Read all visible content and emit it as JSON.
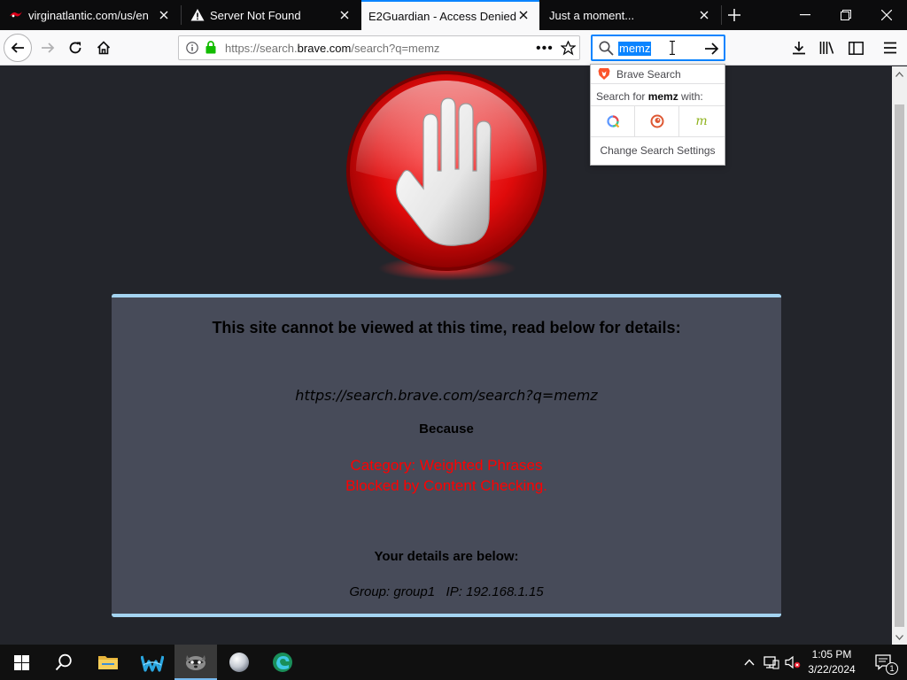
{
  "tabs": [
    {
      "title": "virginatlantic.com/us/en",
      "favicon": "virgin-atlantic-icon",
      "active": false
    },
    {
      "title": "Server Not Found",
      "favicon": "warning-icon",
      "active": false
    },
    {
      "title": "E2Guardian - Access Denied",
      "favicon": "",
      "active": true
    },
    {
      "title": "Just a moment...",
      "favicon": "",
      "active": false
    }
  ],
  "navbar": {
    "url_prefix": "https://search.",
    "url_domain": "brave.com",
    "url_suffix": "/search?q=memz",
    "search_query": "memz"
  },
  "search_popup": {
    "engine_name": "Brave Search",
    "search_for_prefix": "Search for ",
    "search_for_term": "memz",
    "search_for_suffix": " with:",
    "settings_label": "Change Search Settings"
  },
  "page": {
    "headline": "This site cannot be viewed at this time, read below for details:",
    "blocked_url": "https://search.brave.com/search?q=memz",
    "because": "Because",
    "reason_category": "Category: Weighted Phrases",
    "reason_detail": "Blocked by Content Checking.",
    "details_title": "Your details are below:",
    "details": "Group: group1   IP: 192.168.1.15"
  },
  "taskbar": {
    "time": "1:05 PM",
    "date": "3/22/2024",
    "notification_count": "1"
  },
  "colors": {
    "accent": "#0a84ff",
    "panel_bg": "#474b59",
    "panel_border": "#a4d4f1",
    "reason_red": "#ff0000",
    "page_bg": "#23252b"
  }
}
